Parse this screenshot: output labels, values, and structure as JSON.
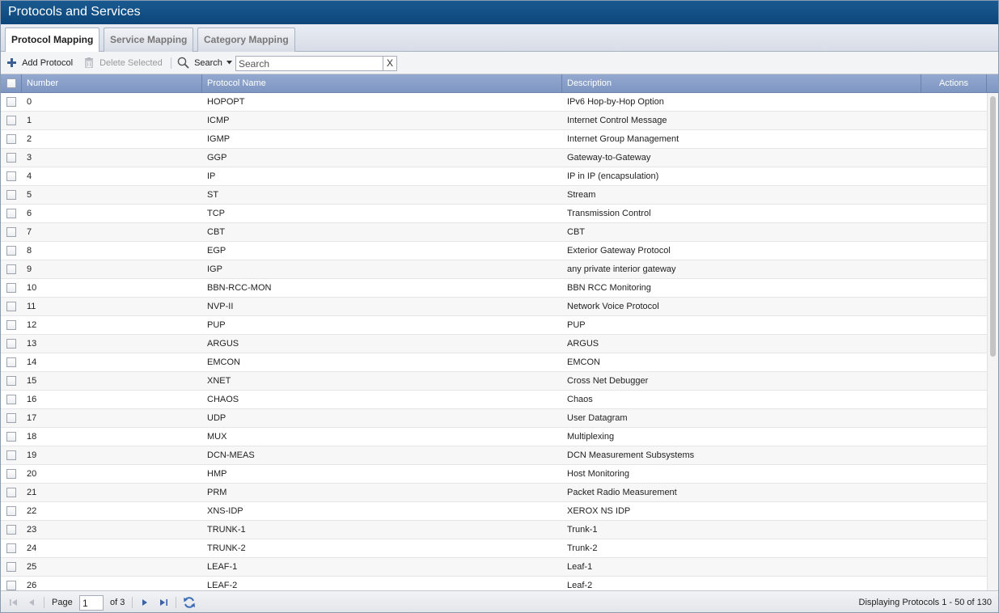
{
  "window": {
    "title": "Protocols and Services"
  },
  "tabs": [
    {
      "label": "Protocol Mapping",
      "active": true
    },
    {
      "label": "Service Mapping",
      "active": false
    },
    {
      "label": "Category Mapping",
      "active": false
    }
  ],
  "toolbar": {
    "add_label": "Add Protocol",
    "delete_label": "Delete Selected",
    "search_label": "Search",
    "search_placeholder": "Search",
    "clear_label": "X"
  },
  "grid": {
    "columns": {
      "number": "Number",
      "name": "Protocol Name",
      "description": "Description",
      "actions": "Actions"
    },
    "rows": [
      {
        "number": "0",
        "name": "HOPOPT",
        "description": "IPv6 Hop-by-Hop Option"
      },
      {
        "number": "1",
        "name": "ICMP",
        "description": "Internet Control Message"
      },
      {
        "number": "2",
        "name": "IGMP",
        "description": "Internet Group Management"
      },
      {
        "number": "3",
        "name": "GGP",
        "description": "Gateway-to-Gateway"
      },
      {
        "number": "4",
        "name": "IP",
        "description": "IP in IP (encapsulation)"
      },
      {
        "number": "5",
        "name": "ST",
        "description": "Stream"
      },
      {
        "number": "6",
        "name": "TCP",
        "description": "Transmission Control"
      },
      {
        "number": "7",
        "name": "CBT",
        "description": "CBT"
      },
      {
        "number": "8",
        "name": "EGP",
        "description": "Exterior Gateway Protocol"
      },
      {
        "number": "9",
        "name": "IGP",
        "description": "any private interior gateway"
      },
      {
        "number": "10",
        "name": "BBN-RCC-MON",
        "description": "BBN RCC Monitoring"
      },
      {
        "number": "11",
        "name": "NVP-II",
        "description": "Network Voice Protocol"
      },
      {
        "number": "12",
        "name": "PUP",
        "description": "PUP"
      },
      {
        "number": "13",
        "name": "ARGUS",
        "description": "ARGUS"
      },
      {
        "number": "14",
        "name": "EMCON",
        "description": "EMCON"
      },
      {
        "number": "15",
        "name": "XNET",
        "description": "Cross Net Debugger"
      },
      {
        "number": "16",
        "name": "CHAOS",
        "description": "Chaos"
      },
      {
        "number": "17",
        "name": "UDP",
        "description": "User Datagram"
      },
      {
        "number": "18",
        "name": "MUX",
        "description": "Multiplexing"
      },
      {
        "number": "19",
        "name": "DCN-MEAS",
        "description": "DCN Measurement Subsystems"
      },
      {
        "number": "20",
        "name": "HMP",
        "description": "Host Monitoring"
      },
      {
        "number": "21",
        "name": "PRM",
        "description": "Packet Radio Measurement"
      },
      {
        "number": "22",
        "name": "XNS-IDP",
        "description": "XEROX NS IDP"
      },
      {
        "number": "23",
        "name": "TRUNK-1",
        "description": "Trunk-1"
      },
      {
        "number": "24",
        "name": "TRUNK-2",
        "description": "Trunk-2"
      },
      {
        "number": "25",
        "name": "LEAF-1",
        "description": "Leaf-1"
      },
      {
        "number": "26",
        "name": "LEAF-2",
        "description": "Leaf-2"
      }
    ]
  },
  "pager": {
    "page_label": "Page",
    "page_value": "1",
    "of_label": "of 3",
    "display_text": "Displaying Protocols 1 - 50 of 130"
  },
  "icons": {
    "add": "plus-icon",
    "delete": "trash-icon",
    "search": "magnifier-icon",
    "dropdown": "caret-down-icon",
    "first": "first-page-icon",
    "prev": "prev-page-icon",
    "next": "next-page-icon",
    "last": "last-page-icon",
    "refresh": "refresh-icon"
  },
  "colors": {
    "titlebar": "#0c467a",
    "grid_header": "#7e96c2",
    "pager_arrow": "#3a62a8"
  }
}
